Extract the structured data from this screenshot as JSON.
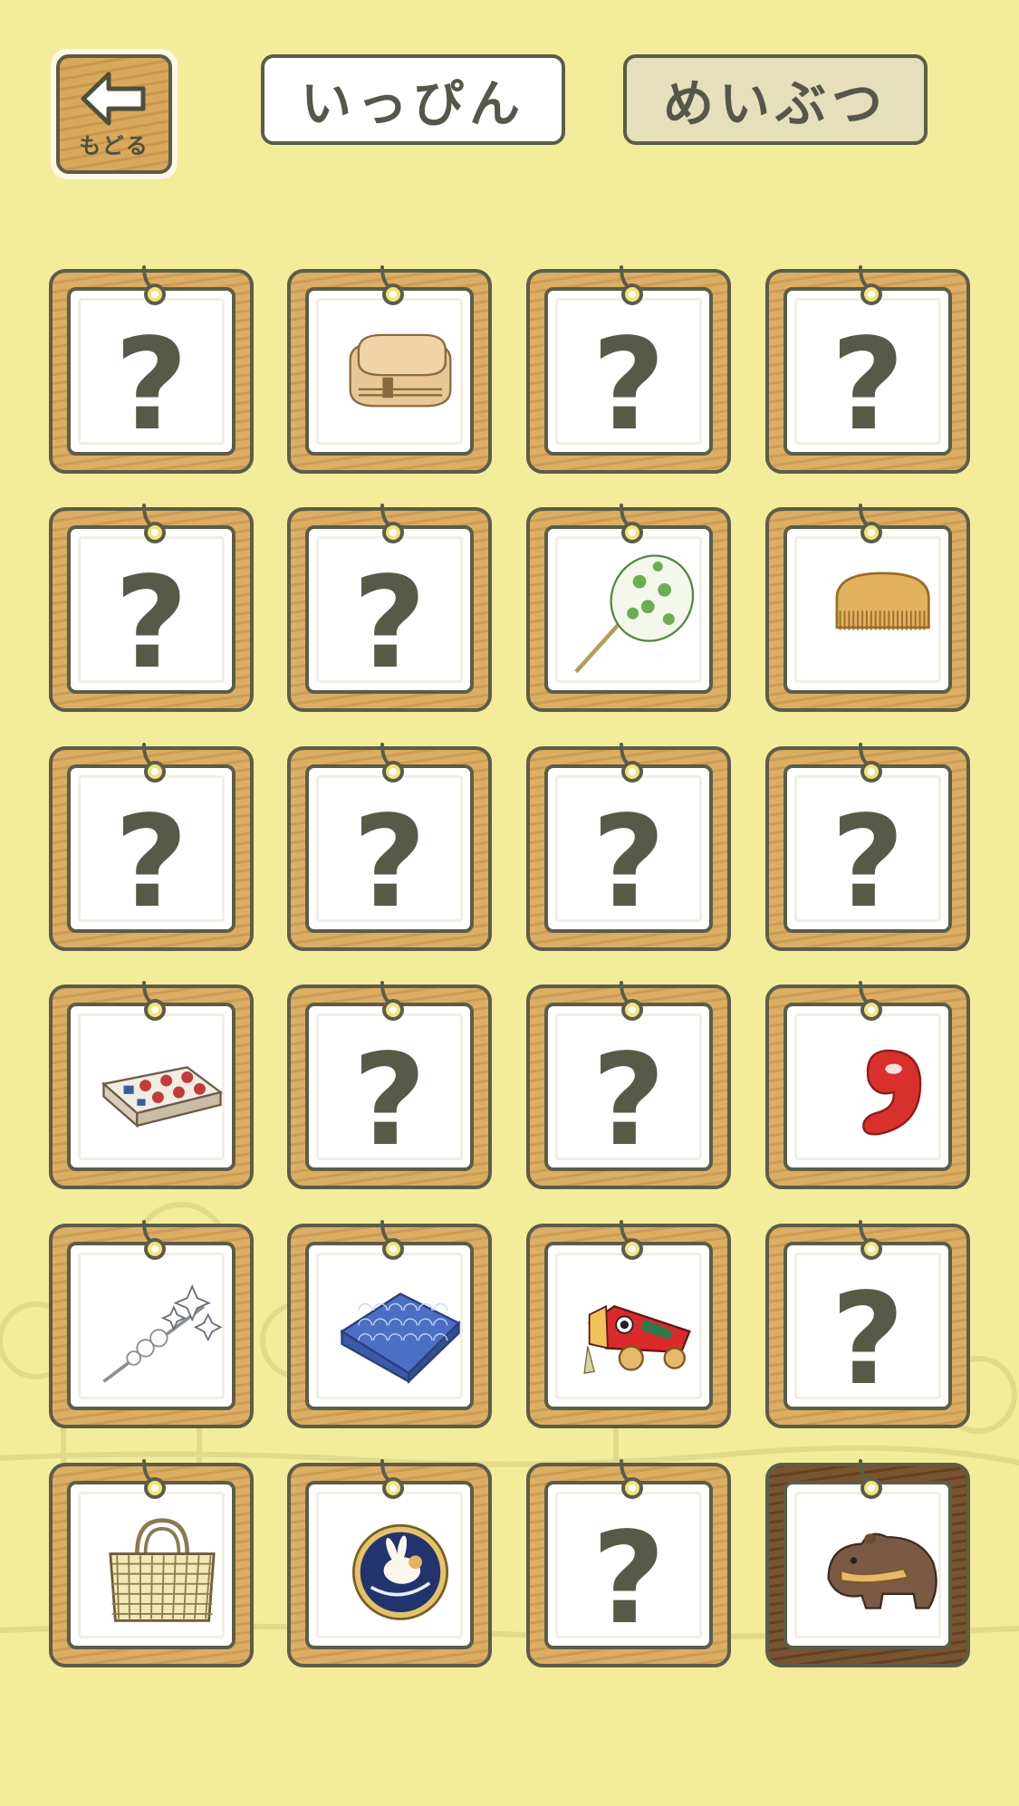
{
  "header": {
    "back_label": "もどる",
    "tabs": [
      {
        "label": "いっぴん",
        "active": true
      },
      {
        "label": "めいぶつ",
        "active": false
      }
    ]
  },
  "collection": {
    "unknown_symbol": "?",
    "cards": [
      {
        "item": "unknown"
      },
      {
        "item": "bento-box"
      },
      {
        "item": "unknown"
      },
      {
        "item": "unknown"
      },
      {
        "item": "unknown"
      },
      {
        "item": "unknown"
      },
      {
        "item": "uchiwa-fan"
      },
      {
        "item": "wooden-comb"
      },
      {
        "item": "unknown"
      },
      {
        "item": "unknown"
      },
      {
        "item": "unknown"
      },
      {
        "item": "unknown"
      },
      {
        "item": "sweets-box"
      },
      {
        "item": "unknown"
      },
      {
        "item": "unknown"
      },
      {
        "item": "magatama"
      },
      {
        "item": "pearl-hairpin"
      },
      {
        "item": "furoshiki"
      },
      {
        "item": "akabeko-toy"
      },
      {
        "item": "unknown"
      },
      {
        "item": "basket-bag"
      },
      {
        "item": "rabbit-badge"
      },
      {
        "item": "unknown"
      },
      {
        "item": "bear-carving"
      }
    ]
  },
  "colors": {
    "background": "#f3ec9a",
    "frame_wood": "#dcae63",
    "frame_dark_wood": "#7a5330",
    "outline": "#5b5d49"
  }
}
